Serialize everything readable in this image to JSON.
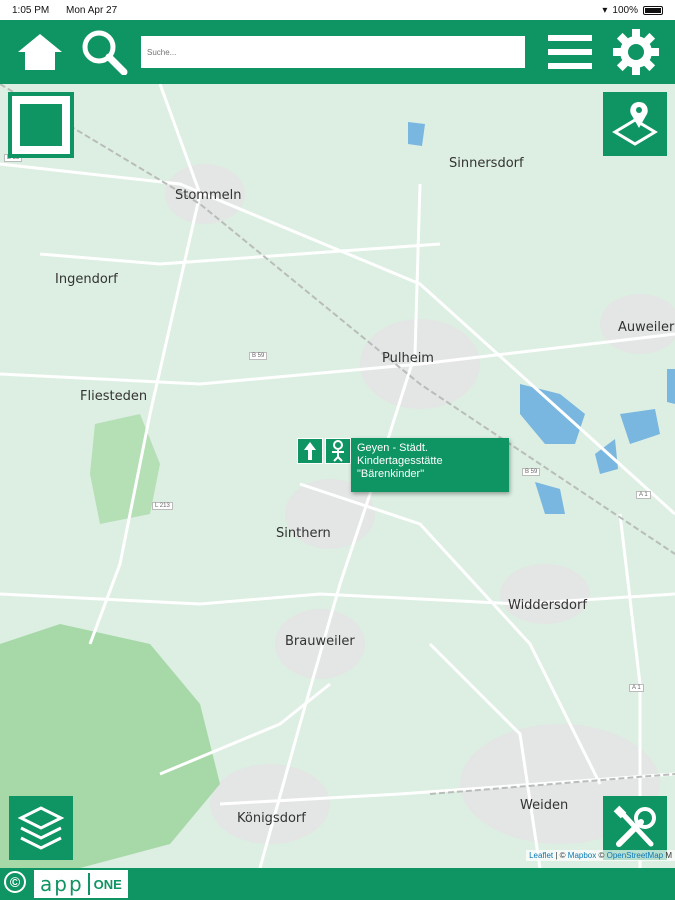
{
  "status_bar": {
    "time": "1:05 PM",
    "date": "Mon Apr 27",
    "battery": "100%"
  },
  "toolbar": {
    "home_icon": "home-icon",
    "search_icon": "search-icon",
    "search_placeholder": "Suche...",
    "menu_icon": "menu-icon",
    "settings_icon": "gear-icon"
  },
  "map": {
    "places": [
      {
        "name": "Sinnersdorf"
      },
      {
        "name": "Stommeln"
      },
      {
        "name": "Ingendorf"
      },
      {
        "name": "Pulheim"
      },
      {
        "name": "Auweiler"
      },
      {
        "name": "Fliesteden"
      },
      {
        "name": "Sinthern"
      },
      {
        "name": "Widdersdorf"
      },
      {
        "name": "Brauweiler"
      },
      {
        "name": "Königsdorf"
      },
      {
        "name": "Weiden"
      }
    ],
    "road_labels": [
      "B 59",
      "L 213",
      "B 59",
      "A 1",
      "A 1",
      "B 55"
    ],
    "popup": {
      "text": "Geyen - Städt. Kindertagesstätte \"Bärenkinder\""
    },
    "attribution": {
      "leaflet": "Leaflet",
      "mapbox": "Mapbox",
      "osm": "OpenStreetMap",
      "suffix": "M"
    }
  },
  "colors": {
    "brand": "#0f9463",
    "map_bg": "#dcefe2"
  },
  "bottom_bar": {
    "copyright": "©",
    "brand_app": "app",
    "brand_one": "ONE"
  }
}
